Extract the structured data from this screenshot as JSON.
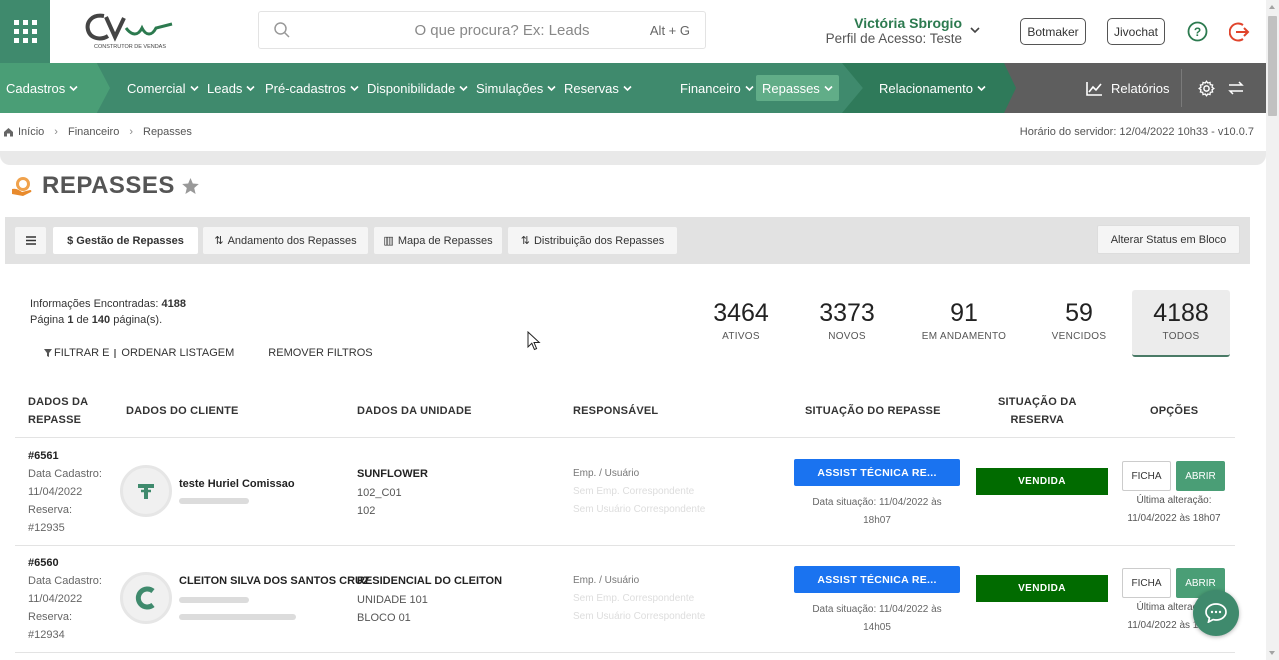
{
  "header": {
    "search_placeholder": "O que procura? Ex: Leads",
    "search_shortcut": "Alt + G",
    "user_name": "Victória Sbrogio",
    "user_profile": "Perfil de Acesso: Teste",
    "botmaker_label": "Botmaker",
    "jivochat_label": "Jivochat",
    "logo_text": "CONSTRUTOR DE VENDAS"
  },
  "nav": {
    "items": [
      {
        "label": "Cadastros"
      },
      {
        "label": "Comercial"
      },
      {
        "label": "Leads"
      },
      {
        "label": "Pré-cadastros"
      },
      {
        "label": "Disponibilidade"
      },
      {
        "label": "Simulações"
      },
      {
        "label": "Reservas"
      },
      {
        "label": "Financeiro"
      },
      {
        "label": "Repasses"
      },
      {
        "label": "Relacionamento"
      }
    ],
    "relatorios_label": "Relatórios"
  },
  "breadcrumb": {
    "items": [
      "Início",
      "Financeiro",
      "Repasses"
    ],
    "server_time": "Horário do servidor: 12/04/2022 10h33 - v10.0.7"
  },
  "page": {
    "title": "REPASSES"
  },
  "tabs": [
    {
      "label": "$ Gestão de Repasses",
      "active": true
    },
    {
      "label": "Andamento dos Repasses"
    },
    {
      "label": "Mapa de Repasses"
    },
    {
      "label": "Distribuição dos Repasses"
    }
  ],
  "bulk_action_label": "Alterar Status em Bloco",
  "info": {
    "found_prefix": "Informações Encontradas: ",
    "found_count": "4188",
    "page_prefix": "Página ",
    "page_current": "1",
    "page_mid": " de ",
    "page_total": "140",
    "page_suffix": " página(s)."
  },
  "filters": {
    "filter_label": "FILTRAR E",
    "order_label": "ORDENAR LISTAGEM",
    "remove_label": "REMOVER FILTROS"
  },
  "stats": [
    {
      "value": "3464",
      "label": "ATIVOS"
    },
    {
      "value": "3373",
      "label": "NOVOS"
    },
    {
      "value": "91",
      "label": "EM ANDAMENTO"
    },
    {
      "value": "59",
      "label": "VENCIDOS"
    },
    {
      "value": "4188",
      "label": "TODOS"
    }
  ],
  "table": {
    "headers": {
      "repasse_l1": "DADOS DA",
      "repasse_l2": "REPASSE",
      "cliente": "DADOS DO CLIENTE",
      "unidade": "DADOS DA UNIDADE",
      "responsavel": "RESPONSÁVEL",
      "situacao": "SITUAÇÃO DO REPASSE",
      "reserva_l1": "SITUAÇÃO DA",
      "reserva_l2": "RESERVA",
      "opcoes": "OPÇÕES"
    },
    "rows": [
      {
        "id": "#6561",
        "cadastro_label": "Data Cadastro:",
        "cadastro_date": "11/04/2022",
        "reserva_label": "Reserva:",
        "reserva_id": "#12935",
        "client_name": "teste Huriel Comissao",
        "unit_name": "SUNFLOWER",
        "unit_code": "102_C01",
        "unit_number": "102",
        "resp_label": "Emp. / Usuário",
        "resp_emp": "Sem Emp. Correspondente",
        "resp_user": "Sem Usuário Correspondente",
        "status": "ASSIST TÉCNICA RE...",
        "status_date_label": "Data situação: 11/04/2022 às",
        "status_date_time": "18h07",
        "reserva_status": "VENDIDA",
        "ficha_label": "FICHA",
        "abrir_label": "ABRIR",
        "last_label": "Última alteração:",
        "last_value": "11/04/2022 às 18h07"
      },
      {
        "id": "#6560",
        "cadastro_label": "Data Cadastro:",
        "cadastro_date": "11/04/2022",
        "reserva_label": "Reserva:",
        "reserva_id": "#12934",
        "client_name": "CLEITON SILVA DOS SANTOS CRUZ",
        "unit_name": "RESIDENCIAL DO CLEITON",
        "unit_code": "UNIDADE 101",
        "unit_number": "BLOCO 01",
        "resp_label": "Emp. / Usuário",
        "resp_emp": "Sem Emp. Correspondente",
        "resp_user": "Sem Usuário Correspondente",
        "status": "ASSIST TÉCNICA RE...",
        "status_date_label": "Data situação: 11/04/2022 às",
        "status_date_time": "14h05",
        "reserva_status": "VENDIDA",
        "ficha_label": "FICHA",
        "abrir_label": "ABRIR",
        "last_label": "Última alteração:",
        "last_value": "11/04/2022 às 18h07"
      }
    ]
  },
  "colors": {
    "brand_green": "#3f8a6d",
    "status_blue": "#1a73f0",
    "sold_green": "#016b00",
    "nav_gray": "#5e5e5e"
  }
}
